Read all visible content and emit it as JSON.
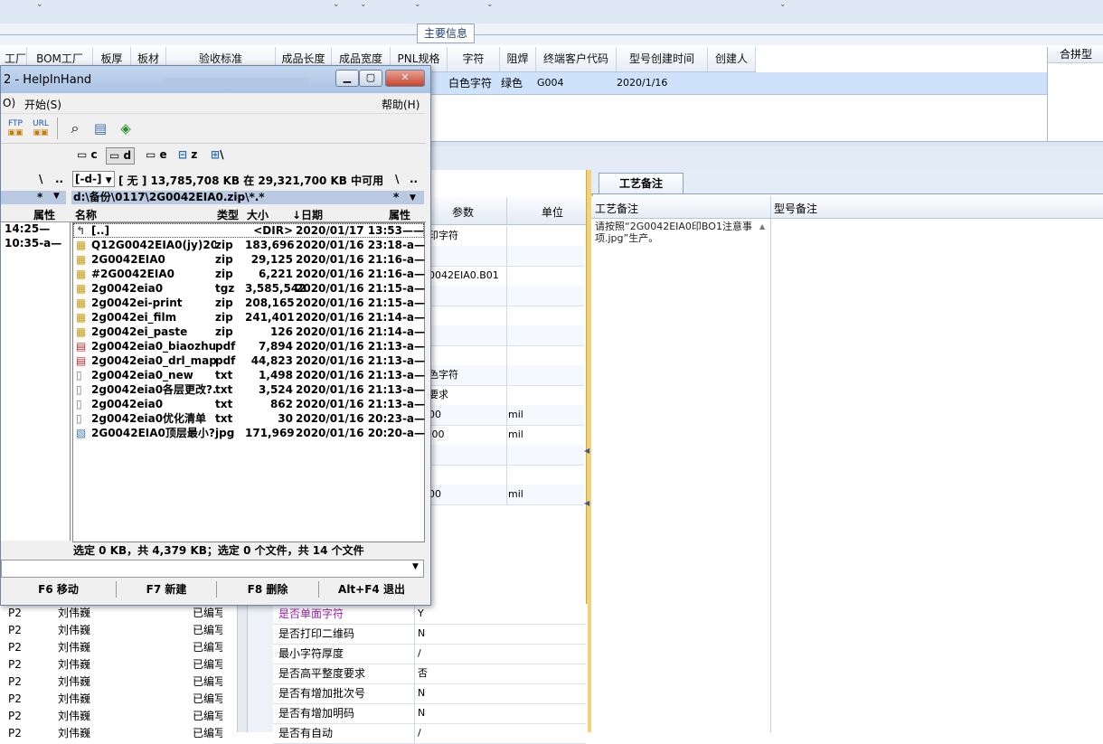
{
  "top_section": {
    "tab_label": "主要信息"
  },
  "main_grid": {
    "columns": [
      "工厂",
      "BOM工厂",
      "板厚",
      "板材",
      "验收标准",
      "成品长度",
      "成品宽度",
      "PNL规格",
      "字符",
      "阻焊",
      "终端客户代码",
      "型号创建时间",
      "创建人"
    ],
    "row": {
      "char": "白色字符",
      "solder": "绿色",
      "customer": "G004",
      "created": "2020/1/16"
    },
    "right_pane_header": "合拼型"
  },
  "params_grid": {
    "headers": {
      "param": "参数",
      "unit": "单位"
    },
    "rows": [
      {
        "param": "印字符",
        "unit": ""
      },
      {
        "param": "",
        "unit": ""
      },
      {
        "param": "0042EIA0.B01",
        "unit": ""
      },
      {
        "param": "",
        "unit": ""
      },
      {
        "param": "",
        "unit": ""
      },
      {
        "param": "",
        "unit": ""
      },
      {
        "param": "",
        "unit": ""
      },
      {
        "param": "色字符",
        "unit": ""
      },
      {
        "param": "要求",
        "unit": ""
      },
      {
        "param": "00",
        "unit": "mil"
      },
      {
        "param": ".00",
        "unit": "mil"
      },
      {
        "param": "",
        "unit": ""
      },
      {
        "param": "",
        "unit": ""
      },
      {
        "param": "00",
        "unit": "mil"
      }
    ]
  },
  "craft": {
    "tab_label": "工艺备注",
    "col1": "工艺备注",
    "col2": "型号备注",
    "note": "请按照“2G0042EIA0印BO1注意事项.jpg”生产。"
  },
  "bottom_left_rows": [
    {
      "code": "P2",
      "name": "刘伟巍",
      "status": "已编写"
    },
    {
      "code": "P2",
      "name": "刘伟巍",
      "status": "已编写"
    },
    {
      "code": "P2",
      "name": "刘伟巍",
      "status": "已编写"
    },
    {
      "code": "P2",
      "name": "刘伟巍",
      "status": "已编写"
    },
    {
      "code": "P2",
      "name": "刘伟巍",
      "status": "已编写"
    },
    {
      "code": "P2",
      "name": "刘伟巍",
      "status": "已编写"
    },
    {
      "code": "P2",
      "name": "刘伟巍",
      "status": "已编写"
    },
    {
      "code": "P2",
      "name": "刘伟巍",
      "status": "已编写"
    }
  ],
  "bottom_right_rows": [
    {
      "label": "是否单面字符",
      "value": "Y"
    },
    {
      "label": "是否打印二维码",
      "value": "N"
    },
    {
      "label": "最小字符厚度",
      "value": "/"
    },
    {
      "label": "是否高平整度要求",
      "value": "否"
    },
    {
      "label": "是否有增加批次号",
      "value": "N"
    },
    {
      "label": "是否有增加明码",
      "value": "N"
    },
    {
      "label": "是否有自动",
      "value": "/"
    }
  ],
  "tc": {
    "title": "2 - HelpInHand",
    "menu": {
      "left": "O)",
      "start": "开始(S)",
      "help": "帮助(H)"
    },
    "drives": {
      "c": "c",
      "d": "d",
      "e": "e",
      "z": "z",
      "net": "\\"
    },
    "drive_combo": "[-d-]",
    "free_space": "[ 无 ]  13,785,708 KB 在 29,321,700 KB 中可用",
    "root_sym": "\\",
    "updir_sym": "..",
    "filter": "*",
    "path": "d:\\备份\\0117\\2G0042EIA0.zip\\*.*",
    "left_header_attr": "属性",
    "headers": {
      "name": "名称",
      "type": "类型",
      "size": "大小",
      "date": "↓日期",
      "attr": "属性"
    },
    "left_rows": [
      "14:25—",
      "10:35-a—"
    ],
    "files": [
      {
        "name": "[..]",
        "type": "",
        "size": "<DIR>",
        "date": "2020/01/17 13:53——",
        "icon": "up"
      },
      {
        "name": "Q12G0042EIA0(jy)20...",
        "type": "zip",
        "size": "183,696",
        "date": "2020/01/16 23:18-a—",
        "icon": "zip"
      },
      {
        "name": "2G0042EIA0",
        "type": "zip",
        "size": "29,125",
        "date": "2020/01/16 21:16-a—",
        "icon": "zip"
      },
      {
        "name": "#2G0042EIA0",
        "type": "zip",
        "size": "6,221",
        "date": "2020/01/16 21:16-a—",
        "icon": "zip"
      },
      {
        "name": "2g0042eia0",
        "type": "tgz",
        "size": "3,585,542",
        "date": "2020/01/16 21:15-a—",
        "icon": "zip"
      },
      {
        "name": "2g0042ei-print",
        "type": "zip",
        "size": "208,165",
        "date": "2020/01/16 21:15-a—",
        "icon": "zip"
      },
      {
        "name": "2g0042ei_film",
        "type": "zip",
        "size": "241,401",
        "date": "2020/01/16 21:14-a—",
        "icon": "zip"
      },
      {
        "name": "2g0042ei_paste",
        "type": "zip",
        "size": "126",
        "date": "2020/01/16 21:14-a—",
        "icon": "zip"
      },
      {
        "name": "2g0042eia0_biaozhu",
        "type": "pdf",
        "size": "7,894",
        "date": "2020/01/16 21:13-a—",
        "icon": "pdf"
      },
      {
        "name": "2g0042eia0_drl_map",
        "type": "pdf",
        "size": "44,823",
        "date": "2020/01/16 21:13-a—",
        "icon": "pdf"
      },
      {
        "name": "2g0042eia0_new",
        "type": "txt",
        "size": "1,498",
        "date": "2020/01/16 21:13-a—",
        "icon": "txt"
      },
      {
        "name": "2g0042eia0各层更改?..",
        "type": "txt",
        "size": "3,524",
        "date": "2020/01/16 21:13-a—",
        "icon": "txt"
      },
      {
        "name": "2g0042eia0",
        "type": "txt",
        "size": "862",
        "date": "2020/01/16 21:13-a—",
        "icon": "txt"
      },
      {
        "name": "2g0042eia0优化清单",
        "type": "txt",
        "size": "30",
        "date": "2020/01/16 20:23-a—",
        "icon": "txt"
      },
      {
        "name": "2G0042EIA0顶层最小?..",
        "type": "jpg",
        "size": "171,969",
        "date": "2020/01/16 20:20-a—",
        "icon": "jpg"
      }
    ],
    "status": "选定 0 KB，共 4,379 KB；选定 0 个文件，共 14 个文件",
    "fkeys": [
      "F6 移动",
      "F7 新建",
      "F8 删除",
      "Alt+F4 退出"
    ]
  }
}
